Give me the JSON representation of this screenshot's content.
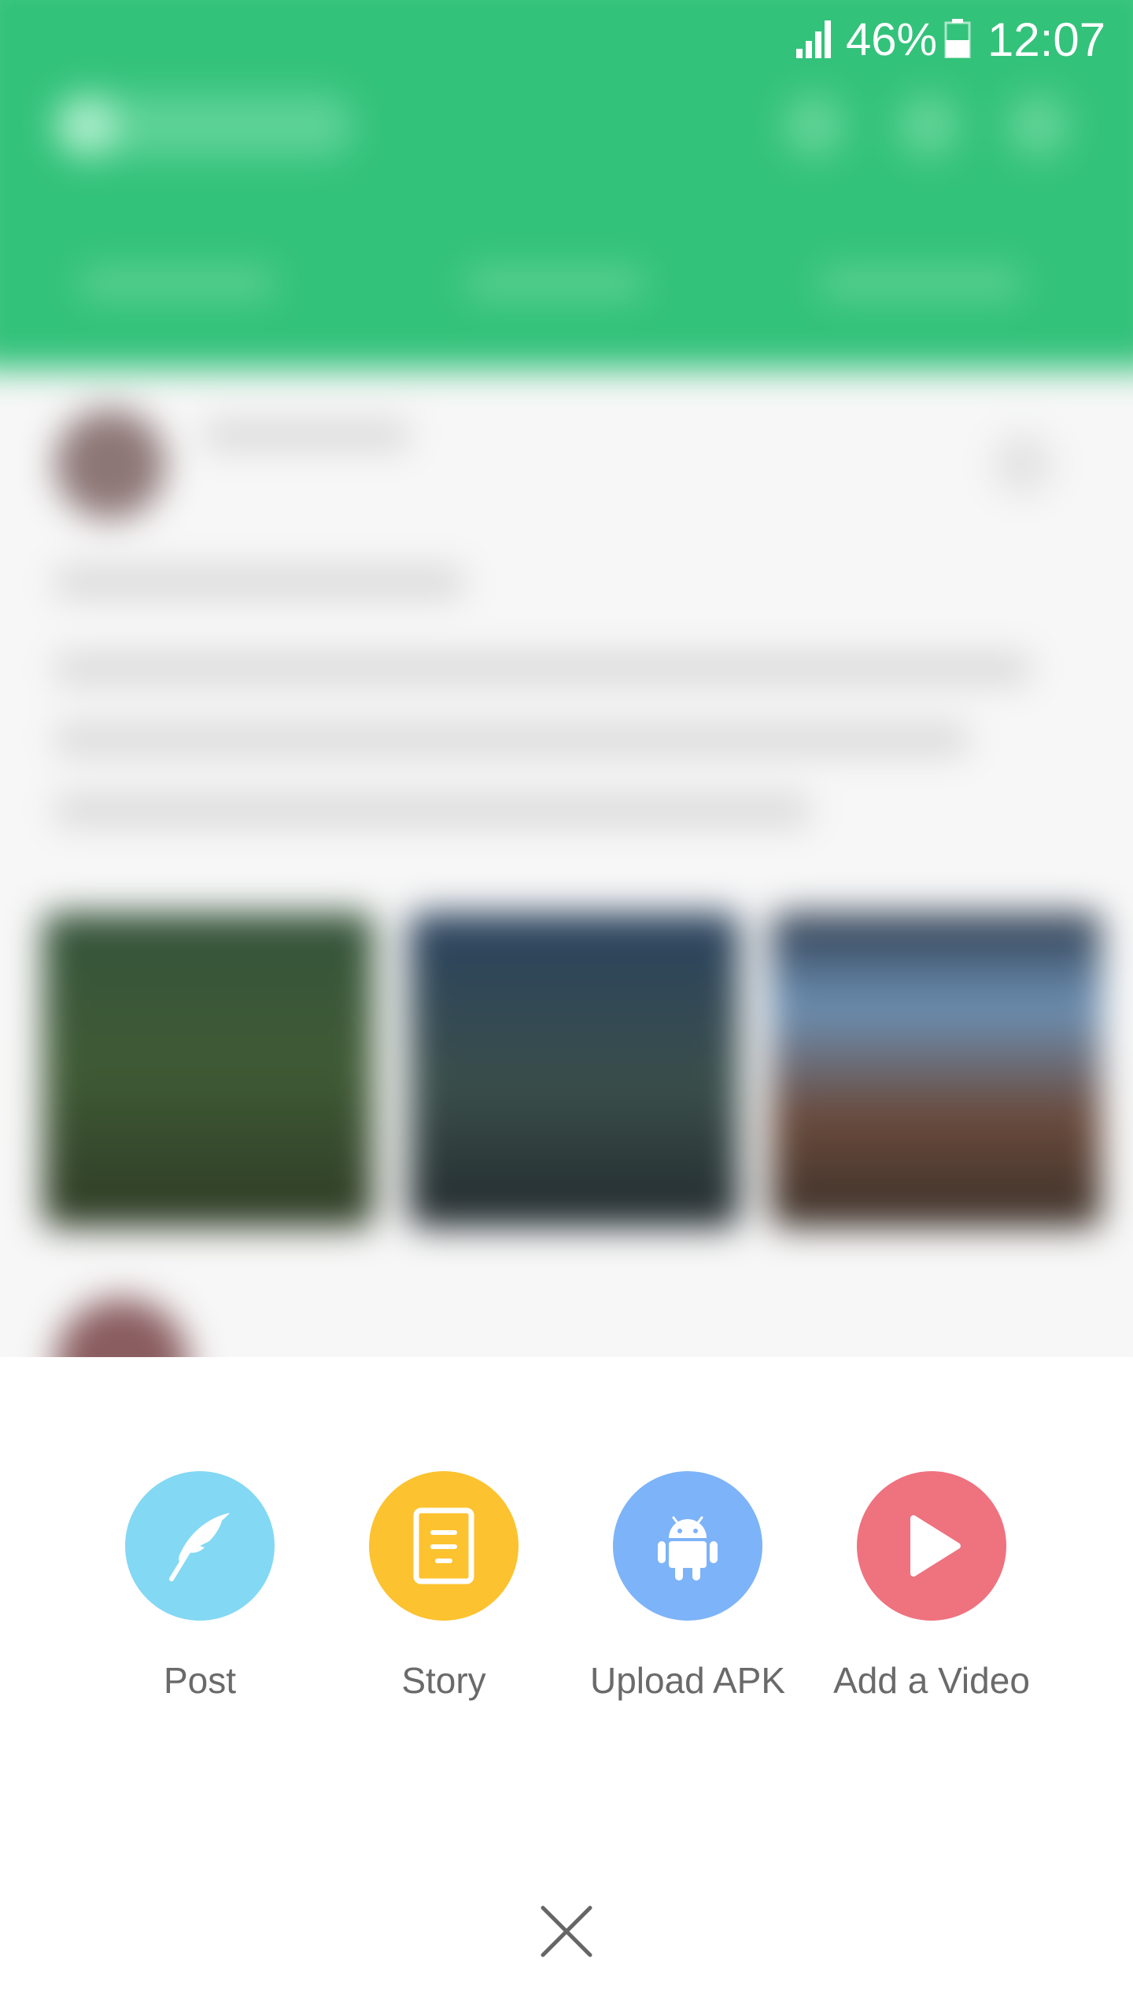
{
  "status_bar": {
    "battery_percent": "46%",
    "time": "12:07",
    "signal_icon": "signal-icon",
    "battery_icon": "battery-icon"
  },
  "background": {
    "header_color": "#33c27a",
    "blurred": true
  },
  "sheet": {
    "actions": [
      {
        "label": "Post",
        "icon": "feather-icon",
        "color": "#83d8f4"
      },
      {
        "label": "Story",
        "icon": "document-icon",
        "color": "#fcc22f"
      },
      {
        "label": "Upload APK",
        "icon": "android-icon",
        "color": "#7db3f8"
      },
      {
        "label": "Add a Video",
        "icon": "play-icon",
        "color": "#ef727f"
      }
    ],
    "close_icon": "close-icon"
  }
}
